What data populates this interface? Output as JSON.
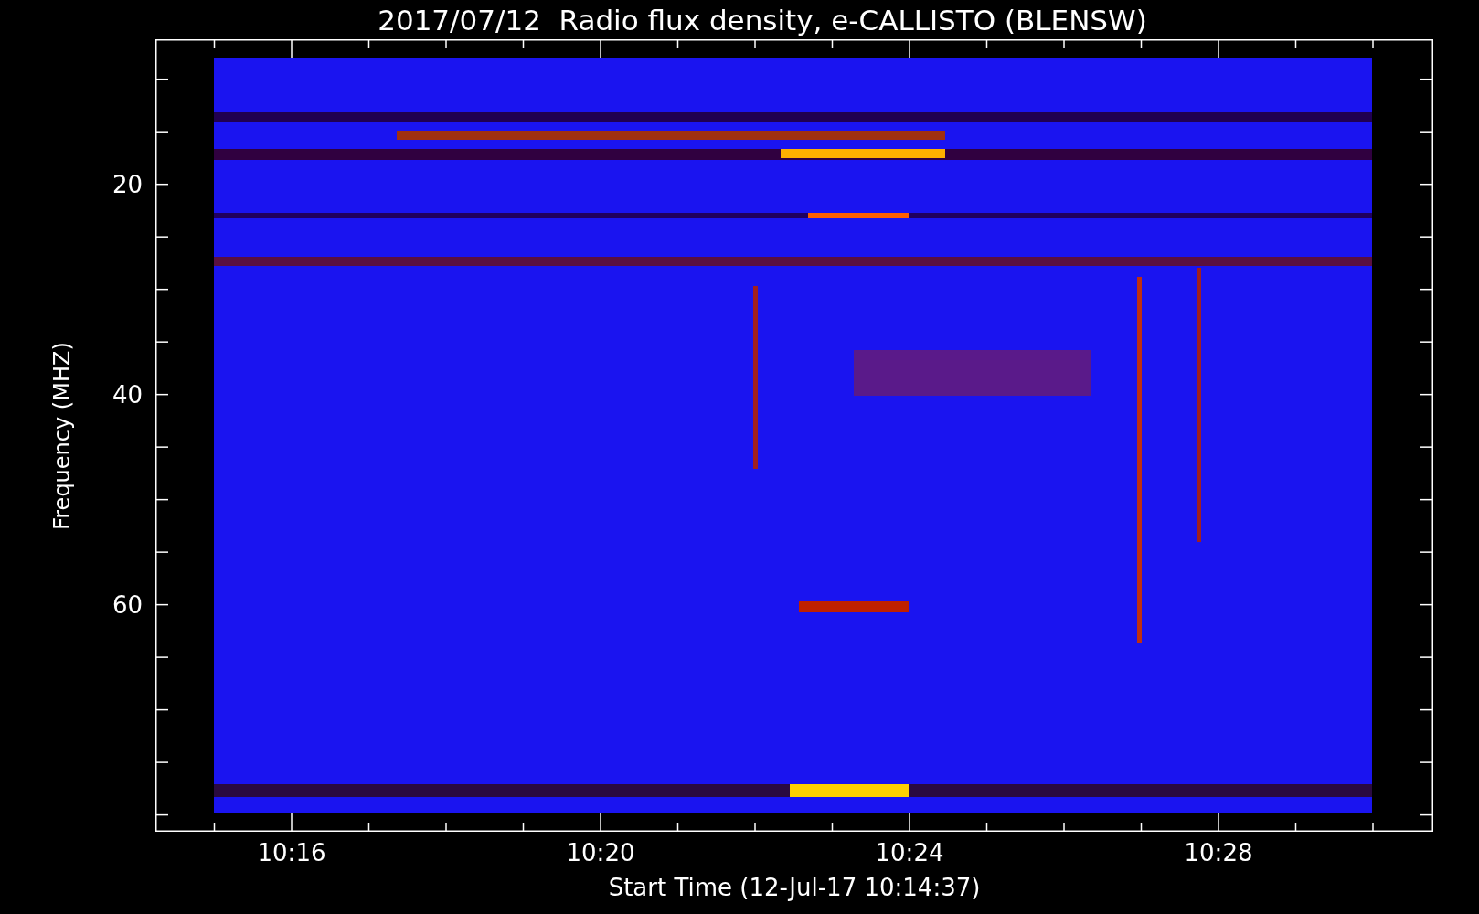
{
  "title": "2017/07/12  Radio flux density, e-CALLISTO (BLENSW)",
  "y_axis": {
    "label": "Frequency (MHZ)",
    "ticks": [
      "20",
      "40",
      "60"
    ]
  },
  "x_axis": {
    "label": "Start Time (12-Jul-17 10:14:37)",
    "ticks": [
      "10:16",
      "10:20",
      "10:24",
      "10:28"
    ]
  }
}
